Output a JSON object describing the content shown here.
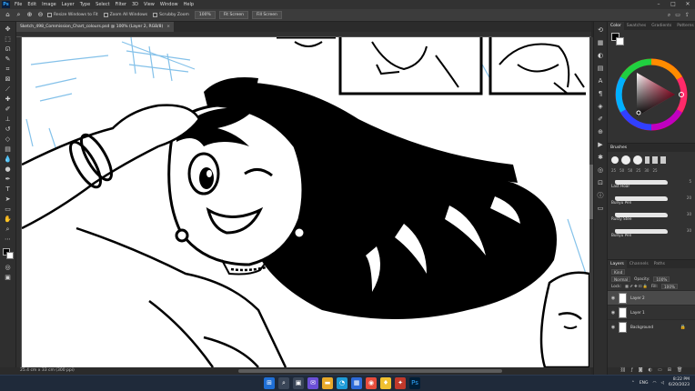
{
  "menubar": {
    "logo": "Ps",
    "items": [
      "File",
      "Edit",
      "Image",
      "Layer",
      "Type",
      "Select",
      "Filter",
      "3D",
      "View",
      "Window",
      "Help"
    ],
    "controls": [
      "–",
      "□",
      "✕"
    ]
  },
  "options": {
    "resize_windows_label": "Resize Windows to Fit",
    "zoom_all_label": "Zoom All Windows",
    "scrubby_label": "Scrubby Zoom",
    "zoom_value": "100%",
    "fit_screen_label": "Fit Screen",
    "fill_screen_label": "Fill Screen"
  },
  "document": {
    "tab_title": "Sketch_498_Commission_Chart_colours.psd @ 100% (Layer 2, RGB/8)",
    "close": "×"
  },
  "status": {
    "text": "25.4 cm x 33 cm (300 ppi)"
  },
  "color_panel": {
    "tabs": [
      "Color",
      "Swatches",
      "Gradients",
      "Patterns"
    ],
    "hue_color": "#e0103a"
  },
  "brushes_panel": {
    "title": "Brushes",
    "sizes": [
      "25",
      "50",
      "50",
      "25",
      "30",
      "25"
    ],
    "brushes": [
      {
        "name": "Last Hoar",
        "num": "5"
      },
      {
        "name": "Bunyu Pen",
        "num": "20"
      },
      {
        "name": "Rusty Stee",
        "num": "30"
      },
      {
        "name": "Bunyu Pen",
        "num": "30"
      }
    ]
  },
  "layers_panel": {
    "tabs": [
      "Layers",
      "Channels",
      "Paths"
    ],
    "kind": "Kind",
    "blend_mode": "Normal",
    "opacity_label": "Opacity:",
    "opacity": "100%",
    "lock_label": "Lock:",
    "fill_label": "Fill:",
    "fill": "100%",
    "layers": [
      {
        "name": "Layer 2",
        "active": true
      },
      {
        "name": "Layer 1",
        "active": false
      },
      {
        "name": "Background",
        "active": false
      }
    ]
  },
  "taskbar": {
    "tray_lang": "ENG",
    "time": "8:22 PM",
    "date": "6/20/2023"
  }
}
